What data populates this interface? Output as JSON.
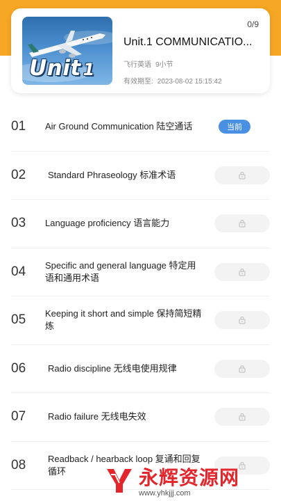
{
  "course": {
    "progress": "0/9",
    "title": "Unit.1 COMMUNICATIO...",
    "category": "飞行英语",
    "lesson_count": "9小节",
    "expiry_label": "有效期至:",
    "expiry_value": "2023-08-02 15:15:42",
    "thumbnail": {
      "word": "Unit",
      "number": "1"
    }
  },
  "lessons": [
    {
      "index": "01",
      "title": "Air Ground Communication 陆空通话",
      "status": "current",
      "badge": "当前"
    },
    {
      "index": "02",
      "title": "Standard Phraseology 标准术语",
      "status": "locked"
    },
    {
      "index": "03",
      "title": "Language proficiency 语言能力",
      "status": "locked"
    },
    {
      "index": "04",
      "title": "Specific and general language 特定用语和通用术语",
      "status": "locked"
    },
    {
      "index": "05",
      "title": "Keeping it short and simple 保持简短精炼",
      "status": "locked"
    },
    {
      "index": "06",
      "title": "Radio discipline 无线电使用规律",
      "status": "locked"
    },
    {
      "index": "07",
      "title": "Radio failure 无线电失效",
      "status": "locked"
    },
    {
      "index": "08",
      "title": "Readback / hearback loop 复诵和回复循环",
      "status": "locked"
    }
  ],
  "watermark": {
    "text": "永辉资源网",
    "url": "www.yhkjjj.com"
  },
  "colors": {
    "accent": "#f5a623",
    "current_badge": "#4a90e2",
    "watermark": "#e2262b"
  }
}
